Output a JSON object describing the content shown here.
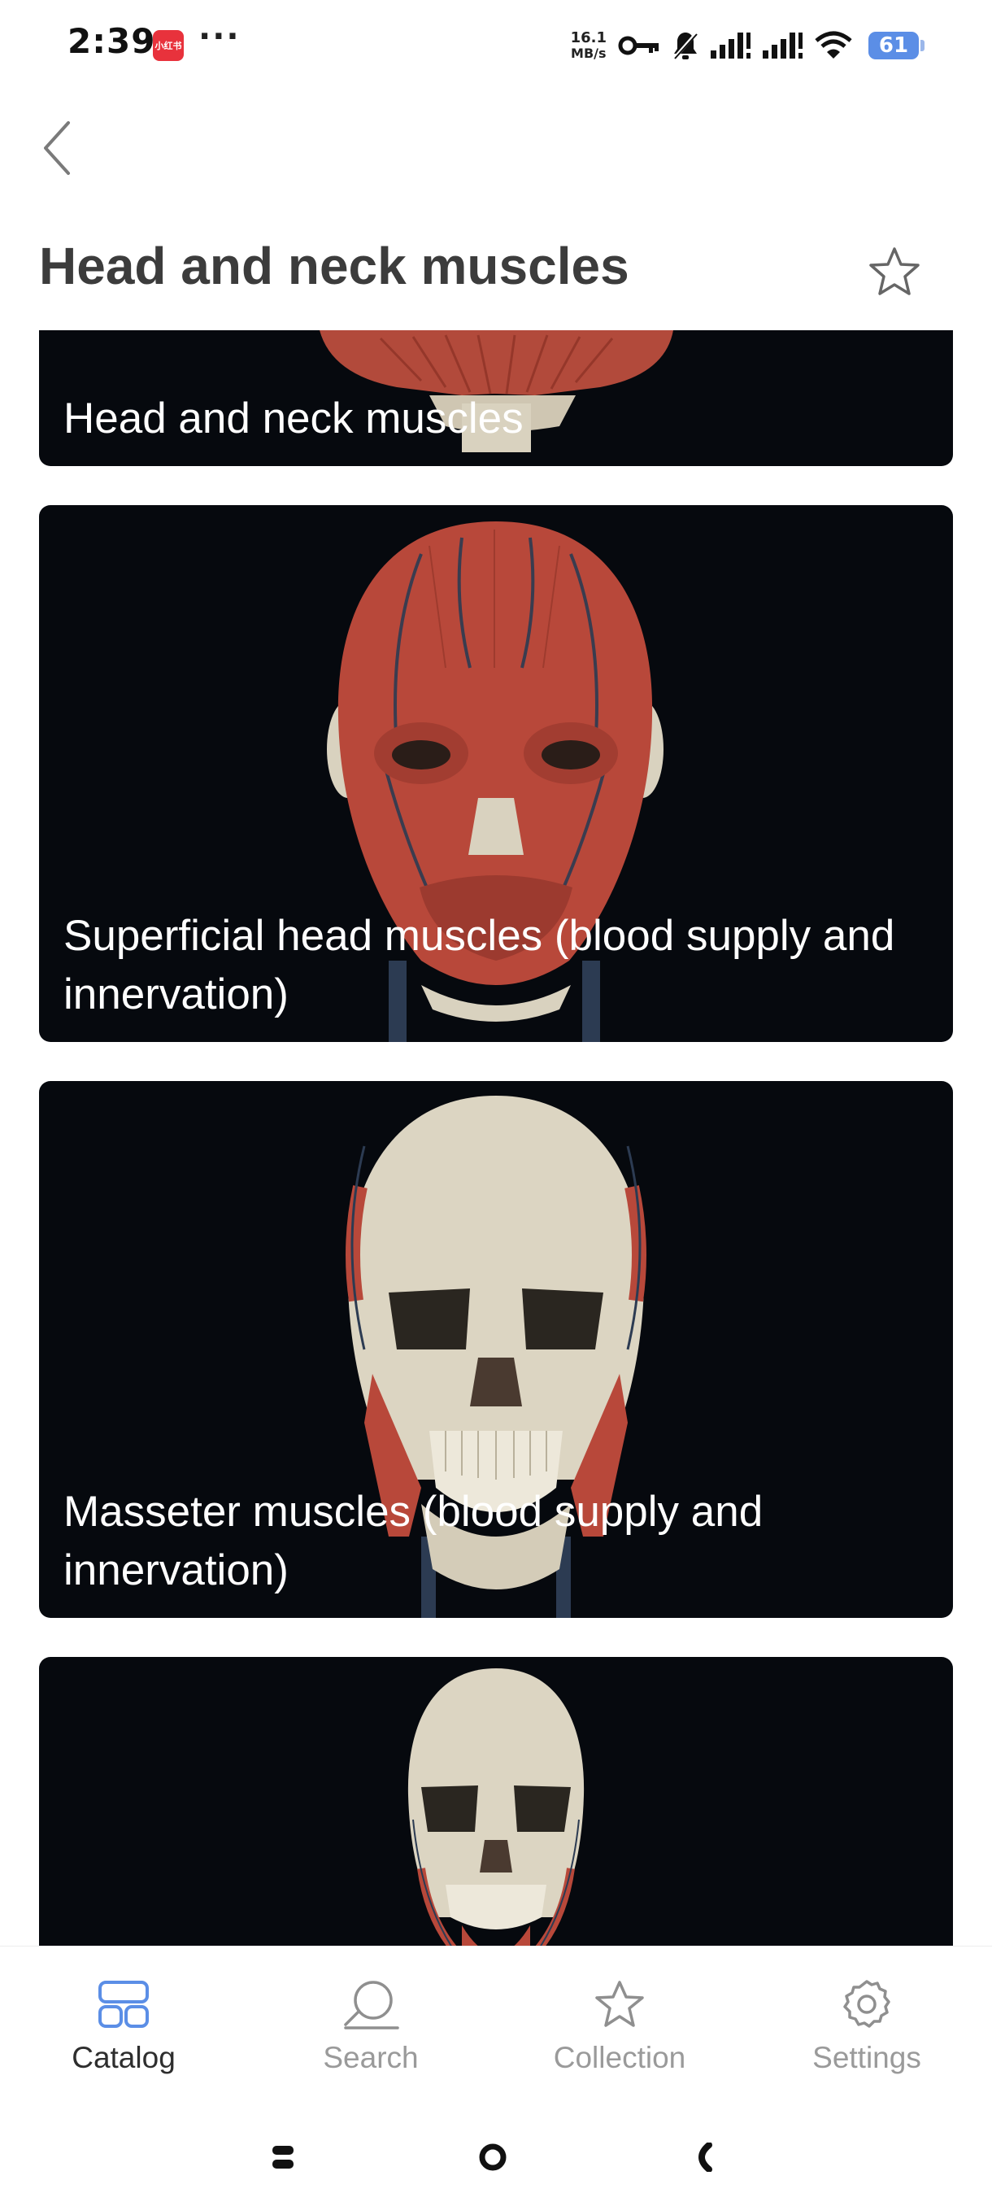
{
  "status_bar": {
    "time": "2:39",
    "app_badge": "小红书",
    "more": "···",
    "net_speed_value": "16.1",
    "net_speed_unit": "MB/s",
    "battery": "61",
    "icons": [
      "key-icon",
      "bell-muted-icon",
      "signal-icon",
      "signal-icon",
      "wifi-icon",
      "battery-icon"
    ]
  },
  "header": {
    "back_icon": "chevron-left-icon",
    "title": "Head and neck muscles",
    "favorite_icon": "star-outline-icon"
  },
  "cards": [
    {
      "label": "Head and neck muscles"
    },
    {
      "label": "Superficial head muscles (blood supply and innervation)"
    },
    {
      "label": "Masseter muscles (blood supply and innervation)"
    },
    {
      "label": ""
    }
  ],
  "bottom_nav": {
    "items": [
      {
        "label": "Catalog",
        "icon": "grid-icon",
        "active": true
      },
      {
        "label": "Search",
        "icon": "search-icon",
        "active": false
      },
      {
        "label": "Collection",
        "icon": "star-icon",
        "active": false
      },
      {
        "label": "Settings",
        "icon": "gear-icon",
        "active": false
      }
    ]
  },
  "colors": {
    "accent": "#5b8ee6",
    "card_bg": "#06090e",
    "muscle": "#b8483a",
    "bone": "#d9d2bf"
  }
}
